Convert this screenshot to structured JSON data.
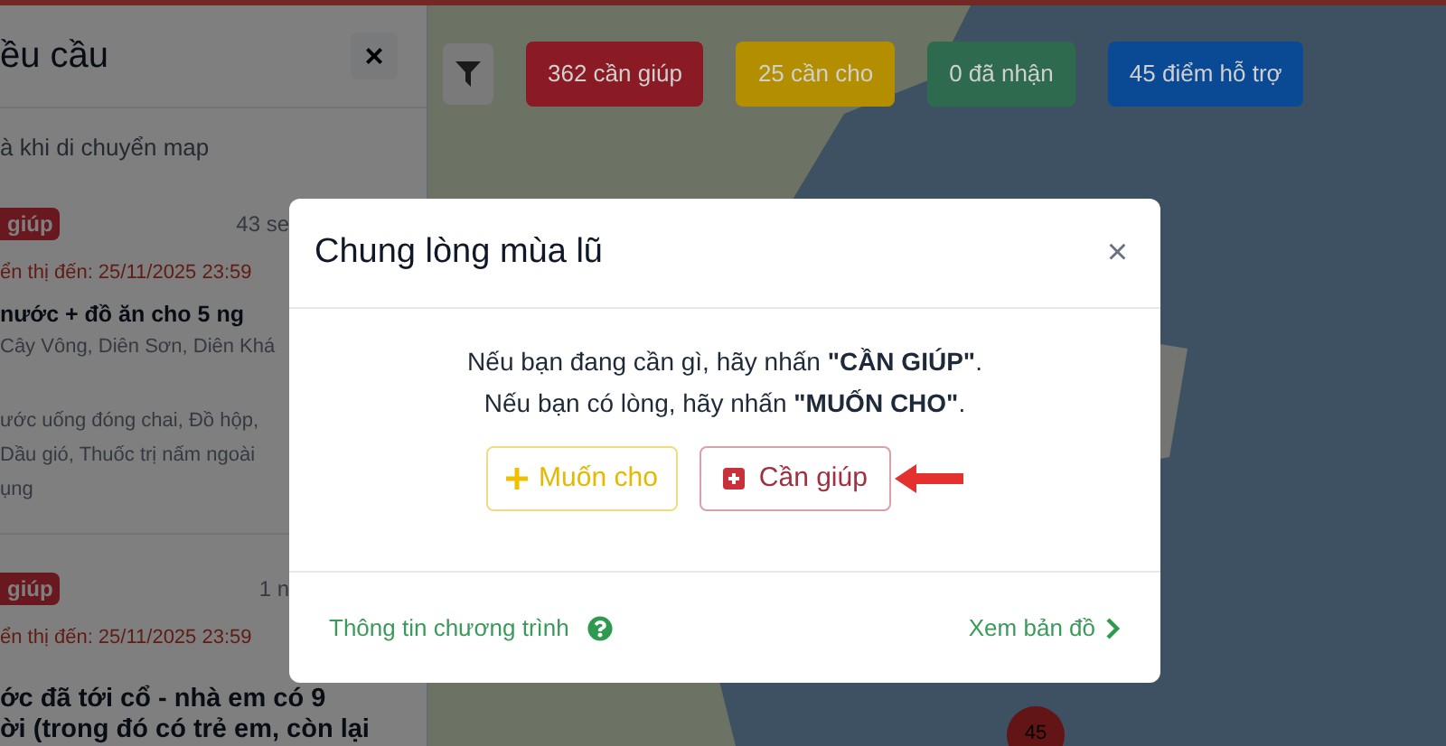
{
  "sidebar": {
    "title": "ều cầu",
    "close": "×",
    "hint": "à khi di chuyển map",
    "requests": [
      {
        "badge": "giúp",
        "time": "43 se",
        "deadline": "ển thị đến: 25/11/2025 23:59",
        "title_lines": [
          "nước + đồ ăn cho 5 ng"
        ],
        "location": "Cây Vông, Diên Sơn, Diên Khá",
        "needs": [
          "ước uống đóng chai, Đồ hộp,",
          "Dầu gió, Thuốc trị nấm ngoài",
          "ụng"
        ]
      },
      {
        "badge": "giúp",
        "time": "1 n",
        "deadline": "ển thị đến: 25/11/2025 23:59",
        "title_lines": [
          "ớc đã tới cổ - nhà em có 9",
          "ời (trong đó có trẻ em, còn lại"
        ]
      }
    ]
  },
  "stats": [
    {
      "label": "362 cần giúp",
      "color": "#8a1a24"
    },
    {
      "label": "25 cần cho",
      "color": "#b38f00"
    },
    {
      "label": "0 đã nhận",
      "color": "#2e6b4e"
    },
    {
      "label": "45 điểm hỗ trợ",
      "color": "#0a4a94"
    }
  ],
  "map": {
    "marker": "45"
  },
  "modal": {
    "title": "Chung lòng mùa lũ",
    "close": "×",
    "lines": [
      "Nếu bạn đang cần gì, hãy nhấn **\"CẦN GIÚP\"**.",
      "Nếu bạn có lòng, hãy nhấn **\"MUỐN CHO\"**."
    ],
    "buttons": [
      {
        "kind": "give",
        "label": "Muốn cho"
      },
      {
        "kind": "need",
        "label": "Cần giúp"
      }
    ],
    "footer_left": "Thông tin chương trình",
    "footer_right": "Xem bản đồ"
  }
}
